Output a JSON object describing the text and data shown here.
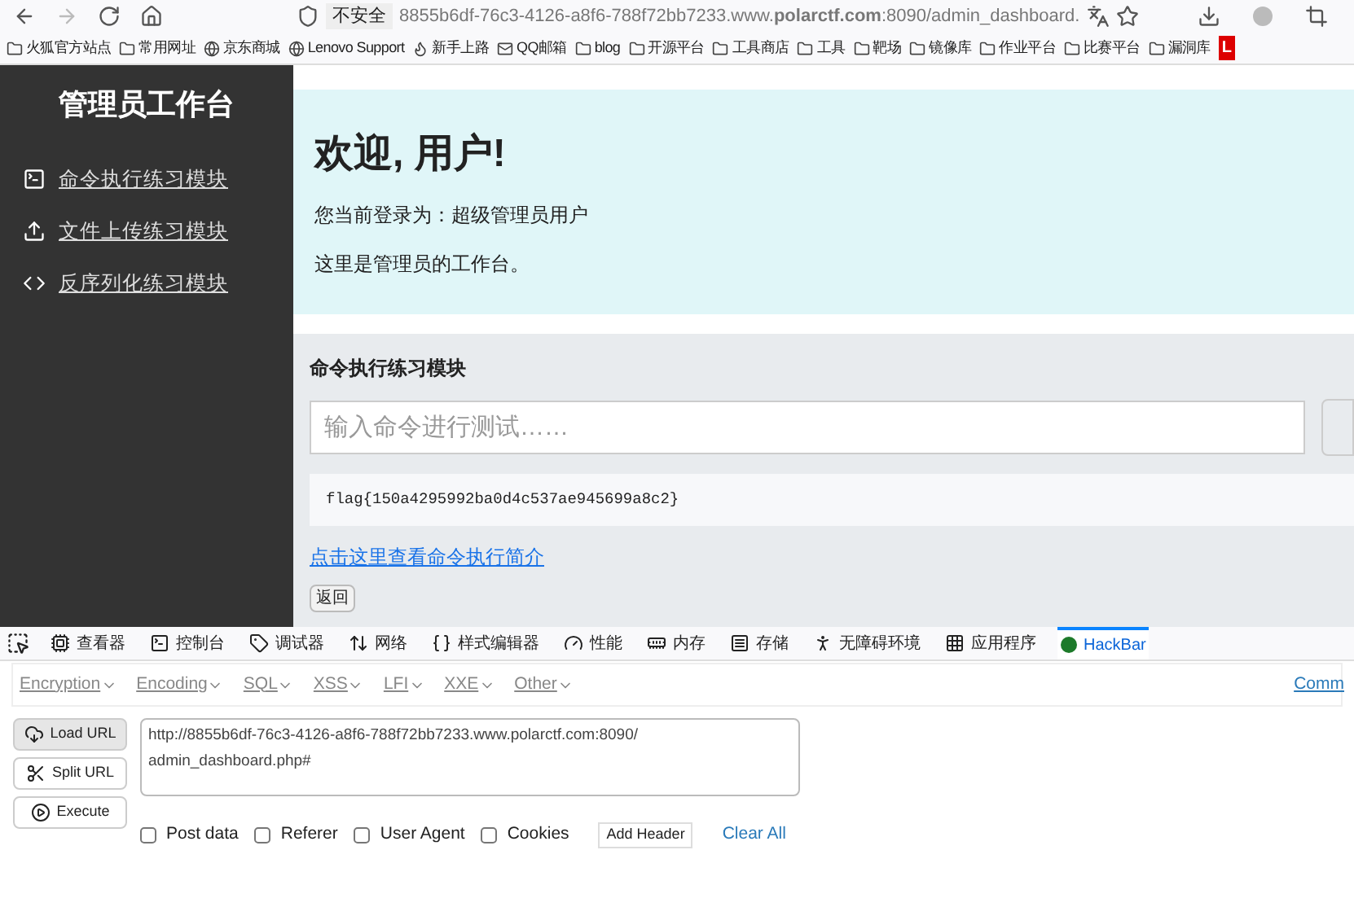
{
  "browser": {
    "security_label": "不安全",
    "url": "8855b6df-76c3-4126-a8f6-788f72bb7233.www.**polarctf.com**:8090/admin_dashboard.",
    "bookmarks": [
      {
        "label": "火狐官方站点",
        "kind": "folder"
      },
      {
        "label": "常用网址",
        "kind": "folder"
      },
      {
        "label": "京东商城",
        "kind": "globe"
      },
      {
        "label": "Lenovo Support",
        "kind": "globe"
      },
      {
        "label": "新手上路",
        "kind": "firefox"
      },
      {
        "label": "QQ邮箱",
        "kind": "mail"
      },
      {
        "label": "blog",
        "kind": "folder"
      },
      {
        "label": "开源平台",
        "kind": "folder"
      },
      {
        "label": "工具商店",
        "kind": "folder"
      },
      {
        "label": "工具",
        "kind": "folder"
      },
      {
        "label": "靶场",
        "kind": "folder"
      },
      {
        "label": "镜像库",
        "kind": "folder"
      },
      {
        "label": "作业平台",
        "kind": "folder"
      },
      {
        "label": "比赛平台",
        "kind": "folder"
      },
      {
        "label": "漏洞库",
        "kind": "folder"
      }
    ],
    "corner_badge": "L"
  },
  "sidebar": {
    "title": "管理员工作台",
    "items": [
      {
        "label": "命令执行练习模块",
        "kind": "terminal"
      },
      {
        "label": "文件上传练习模块",
        "kind": "upload"
      },
      {
        "label": "反序列化练习模块",
        "kind": "code"
      }
    ]
  },
  "welcome": {
    "heading": "欢迎, 用户!",
    "login_line": "您当前登录为：超级管理员用户",
    "description": "这里是管理员的工作台。"
  },
  "module": {
    "title": "命令执行练习模块",
    "command_input": {
      "placeholder": "输入命令进行测试……"
    },
    "output": "flag{150a4295992ba0d4c537ae945699a8c2}",
    "intro_link": "点击这里查看命令执行简介",
    "back_button": "返回"
  },
  "devtools": {
    "tabs": [
      {
        "label": "查看器",
        "kind": "inspector",
        "selected": false
      },
      {
        "label": "控制台",
        "kind": "console",
        "selected": false
      },
      {
        "label": "调试器",
        "kind": "debugger",
        "selected": false
      },
      {
        "label": "网络",
        "kind": "network",
        "selected": false
      },
      {
        "label": "样式编辑器",
        "kind": "style",
        "selected": false
      },
      {
        "label": "性能",
        "kind": "performance",
        "selected": false
      },
      {
        "label": "内存",
        "kind": "memory",
        "selected": false
      },
      {
        "label": "存储",
        "kind": "storage",
        "selected": false
      },
      {
        "label": "无障碍环境",
        "kind": "accessibility",
        "selected": false
      },
      {
        "label": "应用程序",
        "kind": "application",
        "selected": false
      },
      {
        "label": "HackBar",
        "kind": "hackbar",
        "selected": true
      }
    ]
  },
  "hackbar": {
    "menus": [
      "Encryption",
      "Encoding",
      "SQL",
      "XSS",
      "LFI",
      "XXE",
      "Other"
    ],
    "right_link": "Comm",
    "actions": [
      {
        "label": "Load URL",
        "kind": "load",
        "selected": true
      },
      {
        "label": "Split URL",
        "kind": "split",
        "selected": false
      },
      {
        "label": "Execute",
        "kind": "execute",
        "selected": false
      }
    ],
    "url_value": "http://8855b6df-76c3-4126-a8f6-788f72bb7233.www.polarctf.com:8090/\nadmin_dashboard.php#",
    "options": [
      {
        "label": "Post data",
        "checked": false
      },
      {
        "label": "Referer",
        "checked": false
      },
      {
        "label": "User Agent",
        "checked": false
      },
      {
        "label": "Cookies",
        "checked": false
      }
    ],
    "add_header": "Add Header",
    "clear_all": "Clear All"
  }
}
